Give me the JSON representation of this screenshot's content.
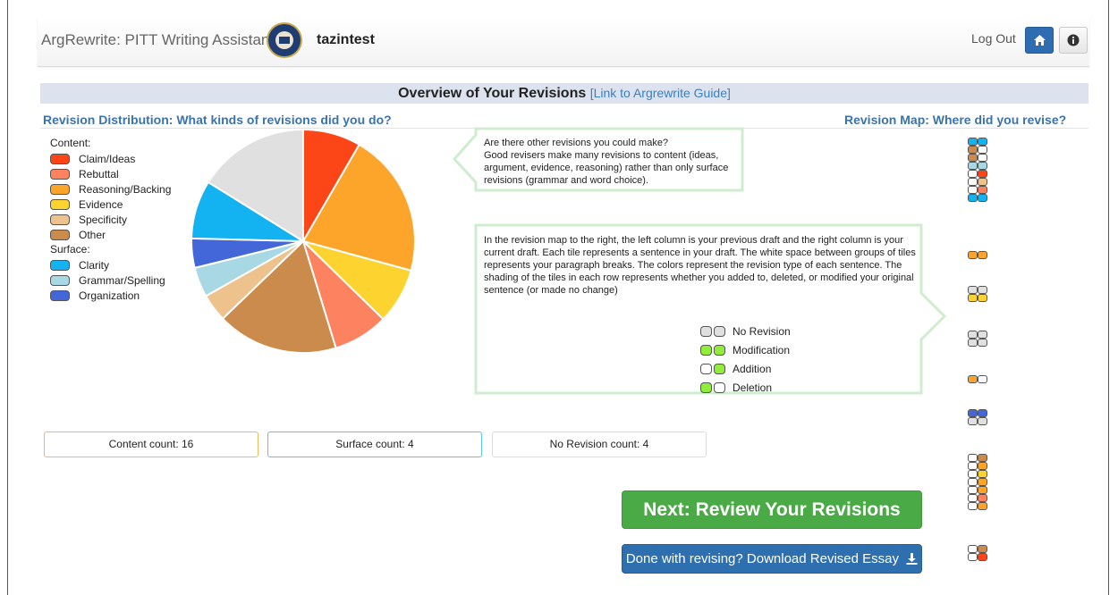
{
  "app": {
    "title": "ArgRewrite: PITT Writing Assistant",
    "username": "tazintest",
    "logout_label": "Log Out"
  },
  "header": {
    "overview_title": "Overview of Your Revisions",
    "guide_link": "[Link to Argrewrite Guide]"
  },
  "sections": {
    "distribution_title": "Revision Distribution: What kinds of revisions did you do?",
    "map_title": "Revision Map: Where did you revise?"
  },
  "legend": {
    "content_label": "Content:",
    "surface_label": "Surface:",
    "items": [
      {
        "label": "Claim/Ideas",
        "color": "#fc4617"
      },
      {
        "label": "Rebuttal",
        "color": "#fd8260"
      },
      {
        "label": "Reasoning/Backing",
        "color": "#fda52b"
      },
      {
        "label": "Evidence",
        "color": "#fdd330"
      },
      {
        "label": "Specificity",
        "color": "#eec28c"
      },
      {
        "label": "Other",
        "color": "#cb8b4c"
      },
      {
        "label": "Clarity",
        "color": "#12b3f0"
      },
      {
        "label": "Grammar/Spelling",
        "color": "#a9d8e5"
      },
      {
        "label": "Organization",
        "color": "#4367d9"
      }
    ]
  },
  "chart_data": {
    "type": "pie",
    "title": "",
    "slices": [
      {
        "label": "Claim/Ideas",
        "value": 8.5,
        "color": "#fc4617"
      },
      {
        "label": "Reasoning/Backing",
        "value": 21.2,
        "color": "#fda52b"
      },
      {
        "label": "Evidence",
        "value": 8.2,
        "color": "#fdd330"
      },
      {
        "label": "Rebuttal",
        "value": 8.1,
        "color": "#fd8260"
      },
      {
        "label": "Other",
        "value": 17.8,
        "color": "#cb8b4c"
      },
      {
        "label": "Specificity",
        "value": 4.1,
        "color": "#eec28c"
      },
      {
        "label": "Grammar/Spelling",
        "value": 4.4,
        "color": "#a9d8e5"
      },
      {
        "label": "Organization",
        "value": 4.3,
        "color": "#4367d9"
      },
      {
        "label": "Clarity",
        "value": 8.6,
        "color": "#12b3f0"
      },
      {
        "label": "No Revision",
        "value": 16.4,
        "color": "#e0e0e0"
      }
    ]
  },
  "callouts": {
    "top_line1": "Are there other revisions you could make?",
    "top_line2": "Good revisers make many revisions to content (ideas, argument, evidence, reasoning) rather than only surface revisions (grammar and word choice).",
    "bottom_text": "In the revision map to the right, the left column is your previous draft and the right column is your current draft. Each tile represents a sentence in your draft. The white space between groups of tiles represents your paragraph breaks. The colors represent the revision type of each sentence. The shading of the tiles in each row represents whether you added to, deleted, or modified your original sentence (or made no change)"
  },
  "map_legend": [
    {
      "label": "No Revision",
      "left": "#e0e0e0",
      "right": "#e0e0e0"
    },
    {
      "label": "Modification",
      "left": "#90ee3a",
      "right": "#90ee3a"
    },
    {
      "label": "Addition",
      "left": "#ffffff",
      "right": "#90ee3a"
    },
    {
      "label": "Deletion",
      "left": "#90ee3a",
      "right": "#ffffff"
    }
  ],
  "stats": {
    "content": "Content count: 16",
    "surface": "Surface count: 4",
    "no_revision": "No Revision count: 4"
  },
  "actions": {
    "next_label": "Next: Review Your Revisions",
    "done_label": "Done with revising? Download Revised Essay"
  },
  "revision_map": {
    "colors": {
      "W": "#ffffff",
      "G": "#e0e0e0",
      "C": "#12b3f0",
      "O": "#cb8b4c",
      "L": "#a9d8e5",
      "R": "#fc4617",
      "S": "#eec28c",
      "B": "#fd8260",
      "A": "#fda52b",
      "E": "#fdd330",
      "N": "#4367d9"
    },
    "groups": [
      [
        "CC",
        "OW",
        "OW",
        "LL",
        "WR",
        "WS",
        "WB",
        "CC"
      ],
      [
        "AA"
      ],
      [
        "GG",
        "EE"
      ],
      [
        "GG",
        "GG"
      ],
      [
        "AW"
      ],
      [
        "NN",
        "GG"
      ],
      [
        "WO",
        "WA",
        "WE",
        "WA",
        "WA",
        "WB",
        "WA"
      ],
      [
        "WO",
        "WR"
      ]
    ]
  }
}
